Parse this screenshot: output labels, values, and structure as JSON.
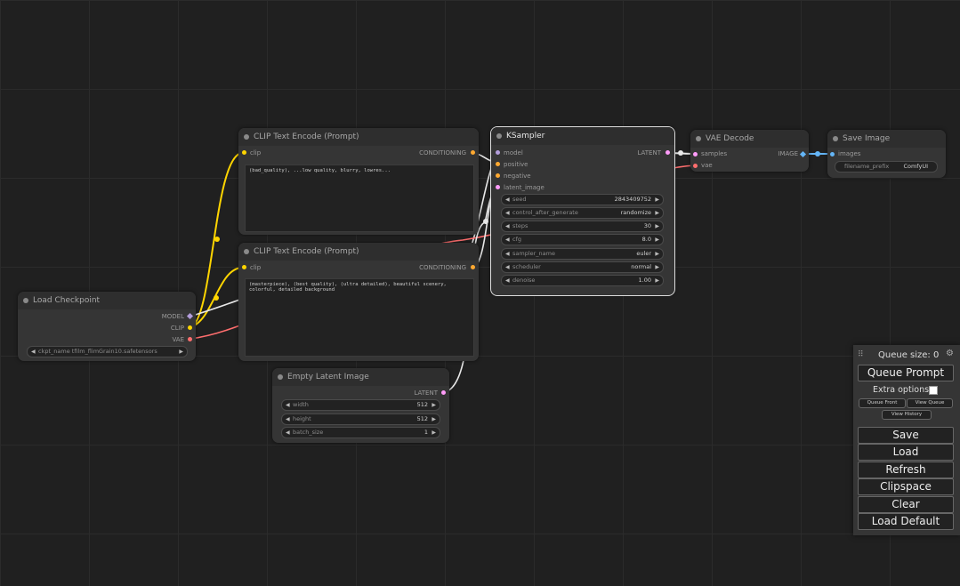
{
  "colors": {
    "clip": "#ffd500",
    "model": "#b39ddb",
    "vae": "#ff6e6e",
    "conditioning": "#ffa931",
    "latent": "#ff9cf9",
    "image": "#64b5f6",
    "wire_white": "#e8e8e8"
  },
  "nodes": {
    "clip_pos": {
      "title": "CLIP Text Encode (Prompt)",
      "input": "clip",
      "output": "CONDITIONING",
      "text": "(bad_quality), ...low quality, blurry, lowres..."
    },
    "clip_neg": {
      "title": "CLIP Text Encode (Prompt)",
      "input": "clip",
      "output": "CONDITIONING",
      "text": "(masterpiece), (best quality), (ultra detailed), beautiful scenery, colorful, detailed background"
    },
    "ksampler": {
      "title": "KSampler",
      "inputs": [
        "model",
        "positive",
        "negative",
        "latent_image"
      ],
      "output": "LATENT",
      "widgets": [
        {
          "label": "seed",
          "value": "2843409752"
        },
        {
          "label": "control_after_generate",
          "value": "randomize"
        },
        {
          "label": "steps",
          "value": "30"
        },
        {
          "label": "cfg",
          "value": "8.0"
        },
        {
          "label": "sampler_name",
          "value": "euler"
        },
        {
          "label": "scheduler",
          "value": "normal"
        },
        {
          "label": "denoise",
          "value": "1.00"
        }
      ]
    },
    "vae_decode": {
      "title": "VAE Decode",
      "inputs": [
        "samples",
        "vae"
      ],
      "output": "IMAGE"
    },
    "save_image": {
      "title": "Save Image",
      "input": "images",
      "widget_label": "filename_prefix",
      "widget_value": "ComfyUI"
    },
    "load_checkpoint": {
      "title": "Load Checkpoint",
      "outputs": [
        "MODEL",
        "CLIP",
        "VAE"
      ],
      "ckpt_value": "ckpt_name  tfilm_flimGrain10.safetensors"
    },
    "empty_latent": {
      "title": "Empty Latent Image",
      "output": "LATENT",
      "widgets": [
        {
          "label": "width",
          "value": "512"
        },
        {
          "label": "height",
          "value": "512"
        },
        {
          "label": "batch_size",
          "value": "1"
        }
      ]
    }
  },
  "queue": {
    "size_label": "Queue size: 0",
    "queue_prompt": "Queue Prompt",
    "extra_options": "Extra options",
    "queue_front": "Queue Front",
    "view_queue": "View Queue",
    "view_history": "View History",
    "save": "Save",
    "load": "Load",
    "refresh": "Refresh",
    "clipspace": "Clipspace",
    "clear": "Clear",
    "load_default": "Load Default",
    "grip_icon": "grip-icon",
    "gear_icon": "gear-icon"
  }
}
